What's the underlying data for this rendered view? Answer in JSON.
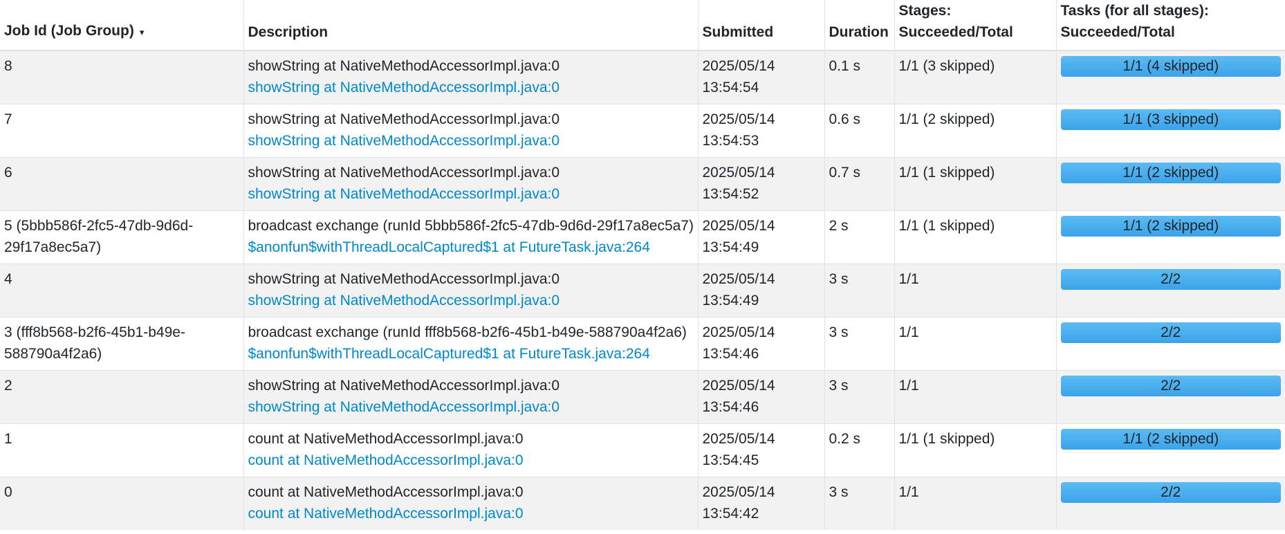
{
  "table": {
    "headers": {
      "job_id": "Job Id (Job Group)",
      "sort_indicator": "▾",
      "description": "Description",
      "submitted": "Submitted",
      "duration": "Duration",
      "stages_line1": "Stages:",
      "stages_line2": "Succeeded/Total",
      "tasks_line1": "Tasks (for all stages):",
      "tasks_line2": "Succeeded/Total"
    },
    "rows": [
      {
        "job_id": "8",
        "desc": "showString at NativeMethodAccessorImpl.java:0",
        "link": "showString at NativeMethodAccessorImpl.java:0",
        "date": "2025/05/14",
        "time": "13:54:54",
        "duration": "0.1 s",
        "stages": "1/1 (3 skipped)",
        "tasks": "1/1 (4 skipped)",
        "tasks_fraction": 1.0
      },
      {
        "job_id": "7",
        "desc": "showString at NativeMethodAccessorImpl.java:0",
        "link": "showString at NativeMethodAccessorImpl.java:0",
        "date": "2025/05/14",
        "time": "13:54:53",
        "duration": "0.6 s",
        "stages": "1/1 (2 skipped)",
        "tasks": "1/1 (3 skipped)",
        "tasks_fraction": 1.0
      },
      {
        "job_id": "6",
        "desc": "showString at NativeMethodAccessorImpl.java:0",
        "link": "showString at NativeMethodAccessorImpl.java:0",
        "date": "2025/05/14",
        "time": "13:54:52",
        "duration": "0.7 s",
        "stages": "1/1 (1 skipped)",
        "tasks": "1/1 (2 skipped)",
        "tasks_fraction": 1.0
      },
      {
        "job_id": "5 (5bbb586f-2fc5-47db-9d6d-29f17a8ec5a7)",
        "desc": "broadcast exchange (runId 5bbb586f-2fc5-47db-9d6d-29f17a8ec5a7)",
        "link": "$anonfun$withThreadLocalCaptured$1 at FutureTask.java:264",
        "date": "2025/05/14",
        "time": "13:54:49",
        "duration": "2 s",
        "stages": "1/1 (1 skipped)",
        "tasks": "1/1 (2 skipped)",
        "tasks_fraction": 1.0
      },
      {
        "job_id": "4",
        "desc": "showString at NativeMethodAccessorImpl.java:0",
        "link": "showString at NativeMethodAccessorImpl.java:0",
        "date": "2025/05/14",
        "time": "13:54:49",
        "duration": "3 s",
        "stages": "1/1",
        "tasks": "2/2",
        "tasks_fraction": 1.0
      },
      {
        "job_id": "3 (fff8b568-b2f6-45b1-b49e-588790a4f2a6)",
        "desc": "broadcast exchange (runId fff8b568-b2f6-45b1-b49e-588790a4f2a6)",
        "link": "$anonfun$withThreadLocalCaptured$1 at FutureTask.java:264",
        "date": "2025/05/14",
        "time": "13:54:46",
        "duration": "3 s",
        "stages": "1/1",
        "tasks": "2/2",
        "tasks_fraction": 1.0
      },
      {
        "job_id": "2",
        "desc": "showString at NativeMethodAccessorImpl.java:0",
        "link": "showString at NativeMethodAccessorImpl.java:0",
        "date": "2025/05/14",
        "time": "13:54:46",
        "duration": "3 s",
        "stages": "1/1",
        "tasks": "2/2",
        "tasks_fraction": 1.0
      },
      {
        "job_id": "1",
        "desc": "count at NativeMethodAccessorImpl.java:0",
        "link": "count at NativeMethodAccessorImpl.java:0",
        "date": "2025/05/14",
        "time": "13:54:45",
        "duration": "0.2 s",
        "stages": "1/1 (1 skipped)",
        "tasks": "1/1 (2 skipped)",
        "tasks_fraction": 1.0
      },
      {
        "job_id": "0",
        "desc": "count at NativeMethodAccessorImpl.java:0",
        "link": "count at NativeMethodAccessorImpl.java:0",
        "date": "2025/05/14",
        "time": "13:54:42",
        "duration": "3 s",
        "stages": "1/1",
        "tasks": "2/2",
        "tasks_fraction": 1.0
      }
    ]
  }
}
